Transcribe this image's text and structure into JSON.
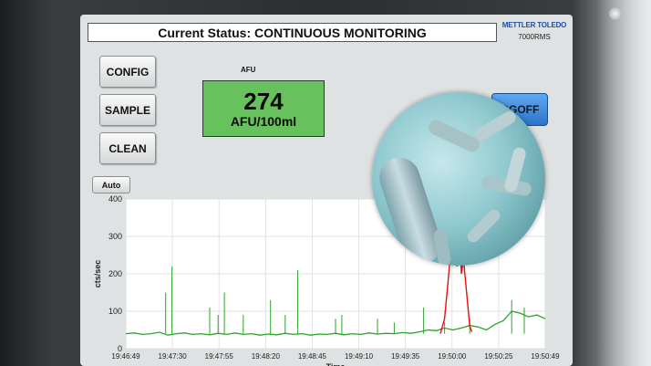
{
  "device": {
    "status_text": "Current Status: CONTINUOUS MONITORING",
    "brand": "METTLER TOLEDO",
    "model": "7000RMS"
  },
  "menu": {
    "config_label": "CONFIG",
    "sample_label": "SAMPLE",
    "clean_label": "CLEAN"
  },
  "afu": {
    "label": "AFU",
    "value": "274",
    "unit": "AFU/100ml",
    "panel_color": "#67c15c"
  },
  "logoff_label": "OGOFF",
  "auto_label": "Auto",
  "chart_data": {
    "type": "line",
    "ylabel": "cts/sec",
    "xlabel": "Time",
    "ylim": [
      0,
      400
    ],
    "y_ticks": [
      "0",
      "100",
      "200",
      "300",
      "400"
    ],
    "x_ticks": [
      "19:46:49",
      "19:47:30",
      "19:47:55",
      "19:48:20",
      "19:48:45",
      "19:49:10",
      "19:49:35",
      "19:50:00",
      "19:50:25",
      "19:50:49"
    ],
    "grid": true,
    "colors": {
      "baseline": "#2aa52a",
      "event": "#e81010"
    },
    "baseline": [
      [
        0,
        40
      ],
      [
        0.02,
        42
      ],
      [
        0.04,
        38
      ],
      [
        0.06,
        40
      ],
      [
        0.08,
        44
      ],
      [
        0.1,
        36
      ],
      [
        0.12,
        40
      ],
      [
        0.14,
        42
      ],
      [
        0.16,
        38
      ],
      [
        0.18,
        40
      ],
      [
        0.2,
        37
      ],
      [
        0.22,
        41
      ],
      [
        0.24,
        38
      ],
      [
        0.26,
        42
      ],
      [
        0.28,
        38
      ],
      [
        0.3,
        40
      ],
      [
        0.32,
        36
      ],
      [
        0.34,
        39
      ],
      [
        0.36,
        37
      ],
      [
        0.38,
        41
      ],
      [
        0.4,
        38
      ],
      [
        0.42,
        40
      ],
      [
        0.44,
        36
      ],
      [
        0.46,
        39
      ],
      [
        0.48,
        38
      ],
      [
        0.5,
        41
      ],
      [
        0.52,
        37
      ],
      [
        0.54,
        40
      ],
      [
        0.56,
        38
      ],
      [
        0.58,
        42
      ],
      [
        0.6,
        39
      ],
      [
        0.62,
        41
      ],
      [
        0.64,
        40
      ],
      [
        0.66,
        43
      ],
      [
        0.68,
        41
      ],
      [
        0.7,
        45
      ],
      [
        0.72,
        50
      ],
      [
        0.74,
        48
      ],
      [
        0.76,
        55
      ],
      [
        0.78,
        50
      ],
      [
        0.8,
        55
      ],
      [
        0.82,
        62
      ],
      [
        0.84,
        58
      ],
      [
        0.86,
        50
      ],
      [
        0.88,
        65
      ],
      [
        0.9,
        75
      ],
      [
        0.92,
        100
      ],
      [
        0.94,
        95
      ],
      [
        0.96,
        85
      ],
      [
        0.98,
        90
      ],
      [
        1.0,
        80
      ]
    ],
    "spikes": [
      [
        0.095,
        150
      ],
      [
        0.11,
        220
      ],
      [
        0.2,
        110
      ],
      [
        0.22,
        90
      ],
      [
        0.235,
        150
      ],
      [
        0.28,
        90
      ],
      [
        0.345,
        130
      ],
      [
        0.38,
        90
      ],
      [
        0.41,
        210
      ],
      [
        0.5,
        80
      ],
      [
        0.515,
        90
      ],
      [
        0.6,
        80
      ],
      [
        0.64,
        70
      ],
      [
        0.71,
        110
      ],
      [
        0.76,
        70
      ],
      [
        0.82,
        80
      ],
      [
        0.92,
        130
      ],
      [
        0.95,
        110
      ]
    ],
    "event": [
      [
        0.75,
        40
      ],
      [
        0.76,
        80
      ],
      [
        0.77,
        200
      ],
      [
        0.775,
        265
      ],
      [
        0.78,
        240
      ],
      [
        0.785,
        285
      ],
      [
        0.79,
        220
      ],
      [
        0.795,
        375
      ],
      [
        0.8,
        200
      ],
      [
        0.805,
        240
      ],
      [
        0.81,
        180
      ],
      [
        0.815,
        120
      ],
      [
        0.82,
        60
      ],
      [
        0.825,
        45
      ]
    ]
  }
}
